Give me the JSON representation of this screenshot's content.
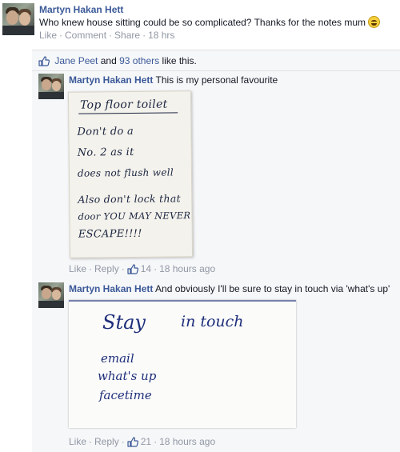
{
  "post": {
    "author": "Martyn Hakan Hett",
    "text": "Who knew house sitting could be so complicated? Thanks for the notes mum",
    "actions": {
      "like": "Like",
      "comment": "Comment",
      "share": "Share"
    },
    "time": "18 hrs"
  },
  "likes": {
    "first_liker": "Jane Peet",
    "connector": "and",
    "others": "93 others",
    "suffix": "like this."
  },
  "comments": [
    {
      "author": "Martyn Hakan Hett",
      "text": "This is my personal favourite",
      "actions": {
        "like": "Like",
        "reply": "Reply"
      },
      "like_count": "14",
      "time": "18 hours ago",
      "note_lines": [
        "Top   floor  toilet",
        "Don't  do   a",
        "No. 2   as  it",
        "does not  flush  well",
        "Also  don't  lock  that",
        "door  YOU  MAY  NEVER",
        "ESCAPE!!!!"
      ]
    },
    {
      "author": "Martyn Hakan Hett",
      "text": "And obviously I'll be sure to stay in touch via 'what's up'",
      "actions": {
        "like": "Like",
        "reply": "Reply"
      },
      "like_count": "21",
      "time": "18 hours ago",
      "note_lines": [
        "Stay",
        "in touch",
        "email",
        "what's up",
        "facetime"
      ]
    }
  ],
  "colors": {
    "link": "#3b5998",
    "meta": "#9197a3",
    "comment_bg": "#f6f7f9"
  },
  "icons": {
    "like": "thumbs-up-icon"
  }
}
